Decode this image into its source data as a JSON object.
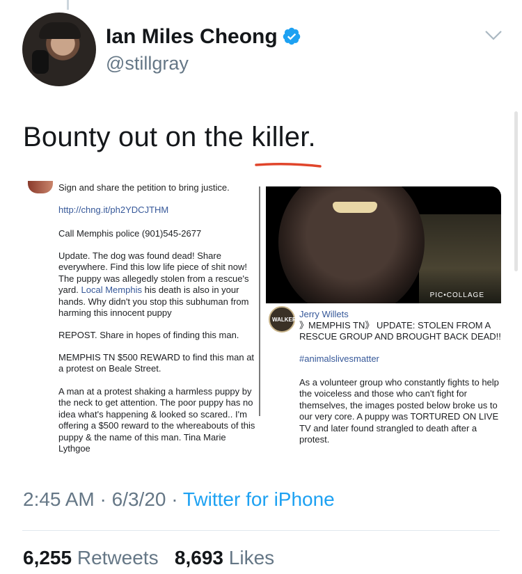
{
  "author": {
    "name": "Ian Miles Cheong",
    "handle": "@stillgray",
    "verified": true
  },
  "tweet": {
    "text": "Bounty out on the killer."
  },
  "media": {
    "left": {
      "top_line": "Sign and share the petition to bring justice.",
      "link": "http://chng.it/ph2YDCJTHM",
      "call": "Call Memphis police (901)545-2677",
      "update_before_link": "Update. The dog was found dead! Share everywhere. Find this low life piece of shit now! The puppy was allegedly stolen from a rescue's yard.",
      "update_link": "Local Memphis",
      "update_after_link": "his death is also in your hands. Why didn't you stop this subhuman from harming this innocent puppy",
      "repost": "REPOST. Share in hopes of finding this man.",
      "reward": "MEMPHIS TN $500 REWARD to find this man at a protest on Beale Street.",
      "story": "A man at a protest shaking a harmless puppy by the neck to get attention. The poor puppy has no idea what's happening & looked so scared.. I'm offering a $500 reward to the whereabouts of this puppy & the name of this man. Tina Marie Lythgoe"
    },
    "right": {
      "watermark": "PIC•COLLAGE",
      "avatar_text": "WALKER",
      "poster_name": "Jerry Willets",
      "title": "》MEMPHIS TN》 UPDATE: STOLEN FROM A RESCUE GROUP AND BROUGHT BACK DEAD!!",
      "hashtag": "#animalslivesmatter",
      "body": "As a volunteer group who constantly fights to help the voiceless and those who can't fight for themselves, the images posted below broke us to our very core. A puppy was TORTURED ON LIVE TV and later found strangled to death after a protest."
    }
  },
  "meta": {
    "time": "2:45 AM",
    "dot1": " · ",
    "date": "6/3/20",
    "dot2": " · ",
    "source": "Twitter for iPhone"
  },
  "stats": {
    "retweets_count": "6,255",
    "retweets_label": "Retweets",
    "likes_count": "8,693",
    "likes_label": "Likes"
  },
  "colors": {
    "link": "#1da1f2",
    "verified": "#1da1f2",
    "secondary_text": "#657786",
    "annotation_underline": "#e0452b"
  },
  "icons": {
    "verified": "verified-badge-icon",
    "more": "chevron-down-icon"
  }
}
